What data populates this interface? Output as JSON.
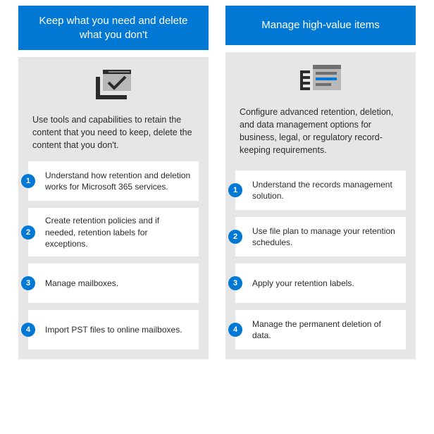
{
  "columns": [
    {
      "title": "Keep what you need and delete what you don't",
      "intro": "Use tools and capabilities to retain the content that you need to keep, delete the content that you don't.",
      "steps": [
        {
          "n": "1",
          "text": "Understand how retention and deletion works for Microsoft 365 services."
        },
        {
          "n": "2",
          "text": "Create retention policies and if needed, retention labels for exceptions."
        },
        {
          "n": "3",
          "text": "Manage mailboxes."
        },
        {
          "n": "4",
          "text": "Import PST files to online mailboxes."
        }
      ]
    },
    {
      "title": "Manage high-value items",
      "intro": "Configure advanced retention, deletion, and data management options for business, legal, or regulatory record-keeping requirements.",
      "steps": [
        {
          "n": "1",
          "text": "Understand the records management solution."
        },
        {
          "n": "2",
          "text": "Use file plan to manage your retention schedules."
        },
        {
          "n": "3",
          "text": "Apply your retention labels."
        },
        {
          "n": "4",
          "text": "Manage the permanent deletion of data."
        }
      ]
    }
  ]
}
